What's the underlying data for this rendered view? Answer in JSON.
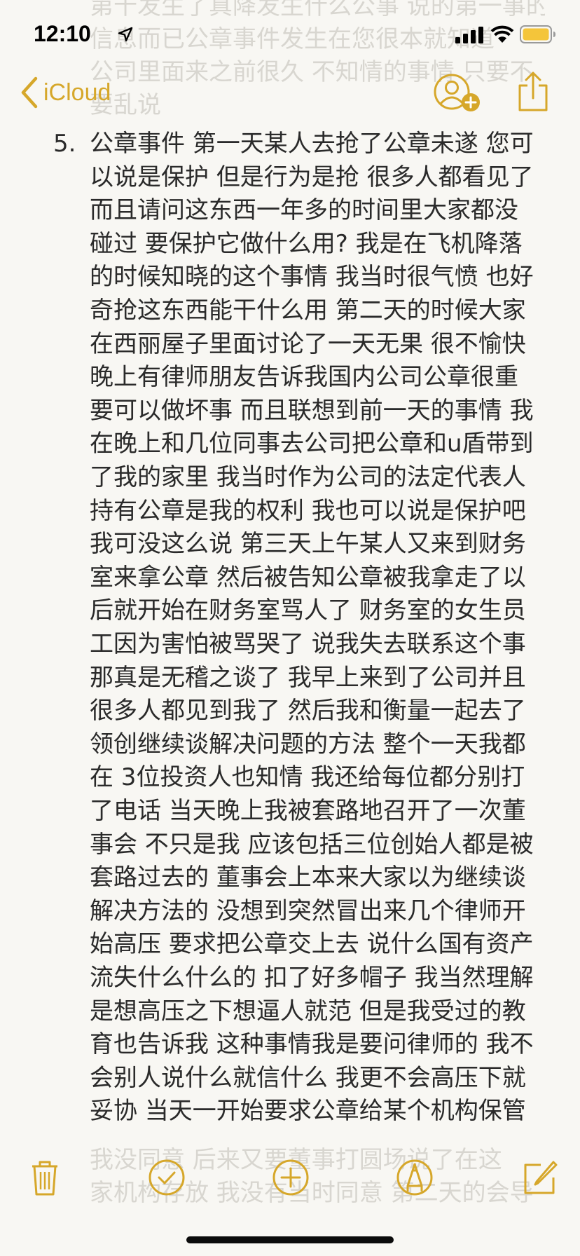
{
  "status_bar": {
    "time": "12:10"
  },
  "nav": {
    "back_label": "iCloud"
  },
  "faded_top_lines": [
    "第十发生了真降发生什么公事 说的第一事的",
    "信息而已公章事件发生在您很本就知道",
    "公司里面来之前很久 不知情的事情 只要不",
    "要乱说"
  ],
  "note": {
    "list_number": "5.",
    "lines": [
      "公章事件 第一天某人去抢了公章未遂 您可",
      "以说是保护 但是行为是抢 很多人都看见了",
      "而且请问这东西一年多的时间里大家都没",
      "碰过 要保护它做什么用? 我是在飞机降落",
      "的时候知晓的这个事情 我当时很气愤 也好",
      "奇抢这东西能干什么用 第二天的时候大家",
      "在西丽屋子里面讨论了一天无果 很不愉快",
      "晚上有律师朋友告诉我国内公司公章很重",
      "要可以做坏事 而且联想到前一天的事情 我",
      "在晚上和几位同事去公司把公章和u盾带到",
      "了我的家里 我当时作为公司的法定代表人",
      "持有公章是我的权利 我也可以说是保护吧",
      "我可没这么说 第三天上午某人又来到财务",
      "室来拿公章 然后被告知公章被我拿走了以",
      "后就开始在财务室骂人了 财务室的女生员",
      "工因为害怕被骂哭了 说我失去联系这个事",
      "那真是无稽之谈了 我早上来到了公司并且",
      "很多人都见到我了 然后我和衡量一起去了",
      "领创继续谈解决问题的方法 整个一天我都",
      "在 3位投资人也知情 我还给每位都分别打",
      "了电话 当天晚上我被套路地召开了一次董",
      "事会 不只是我 应该包括三位创始人都是被",
      "套路过去的 董事会上本来大家以为继续谈",
      "解决方法的 没想到突然冒出来几个律师开",
      "始高压 要求把公章交上去 说什么国有资产",
      "流失什么什么的 扣了好多帽子 我当然理解",
      "是想高压之下想逼人就范 但是我受过的教",
      "育也告诉我 这种事情我是要问律师的 我不",
      "会别人说什么就信什么 我更不会高压下就",
      "妥协 当天一开始要求公章给某个机构保管"
    ]
  },
  "faded_bottom_lines": [
    "我没同意 后来又要董事打圆场说了在这",
    "家机构存放 我没有当时同意 第二天的会导"
  ],
  "toolbar": {
    "items": [
      "trash-icon",
      "checklist-icon",
      "add-icon",
      "markup-icon",
      "compose-icon"
    ]
  },
  "colors": {
    "accent": "#d6a72a",
    "background": "#f8f7f3",
    "text": "#2a2a2a",
    "faded_text": "#d8d6d0"
  }
}
